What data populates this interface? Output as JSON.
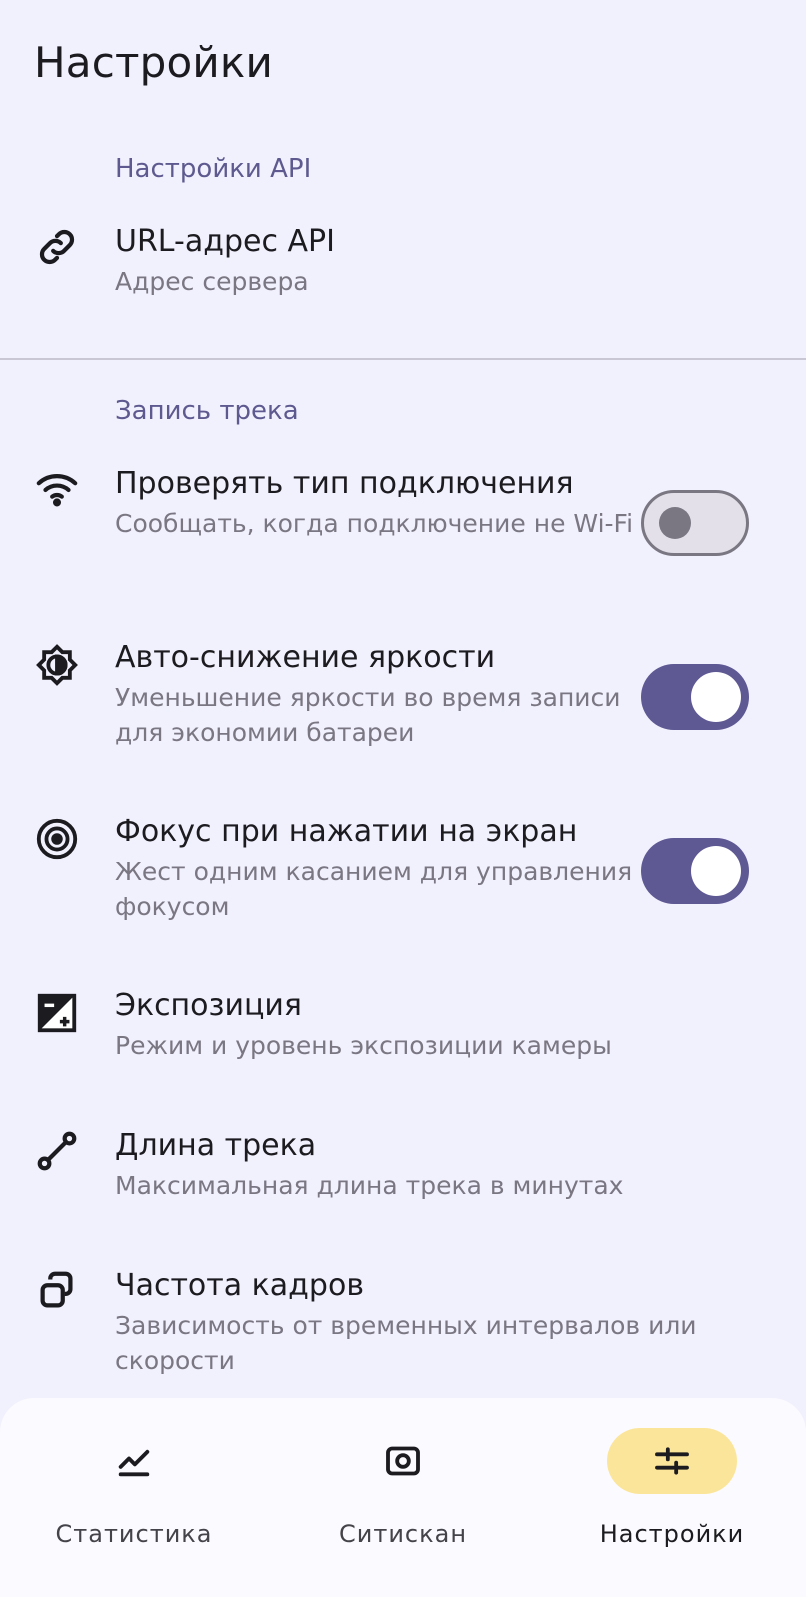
{
  "header": {
    "title": "Настройки"
  },
  "sections": {
    "api": {
      "header": "Настройки API",
      "items": [
        {
          "title": "URL-адрес API",
          "subtitle": "Адрес сервера",
          "icon": "link-icon"
        }
      ]
    },
    "track": {
      "header": "Запись трека",
      "items": [
        {
          "title": "Проверять тип подключения",
          "subtitle": "Сообщать, когда подключение не Wi-Fi",
          "icon": "wifi-icon",
          "toggle": false
        },
        {
          "title": "Авто-снижение яркости",
          "subtitle": "Уменьшение яркости во время записи для экономии батареи",
          "icon": "brightness-icon",
          "toggle": true
        },
        {
          "title": "Фокус при нажатии на экран",
          "subtitle": "Жест одним касанием для управления фокусом",
          "icon": "target-icon",
          "toggle": true
        },
        {
          "title": "Экспозиция",
          "subtitle": "Режим и уровень экспозиции камеры",
          "icon": "exposure-icon"
        },
        {
          "title": "Длина трека",
          "subtitle": "Максимальная длина трека в минутах",
          "icon": "route-icon"
        },
        {
          "title": "Частота кадров",
          "subtitle": "Зависимость от временных интервалов или скорости",
          "icon": "frames-icon"
        }
      ]
    }
  },
  "bottom_nav": {
    "items": [
      {
        "label": "Статистика",
        "icon": "chart-icon",
        "active": false
      },
      {
        "label": "Ситискан",
        "icon": "camera-icon",
        "active": false
      },
      {
        "label": "Настройки",
        "icon": "sliders-icon",
        "active": true
      }
    ]
  },
  "colors": {
    "background": "#f1f0fd",
    "accent": "#5e5893",
    "section_header": "#5e5a8f",
    "active_nav_pill": "#fbe59a"
  }
}
